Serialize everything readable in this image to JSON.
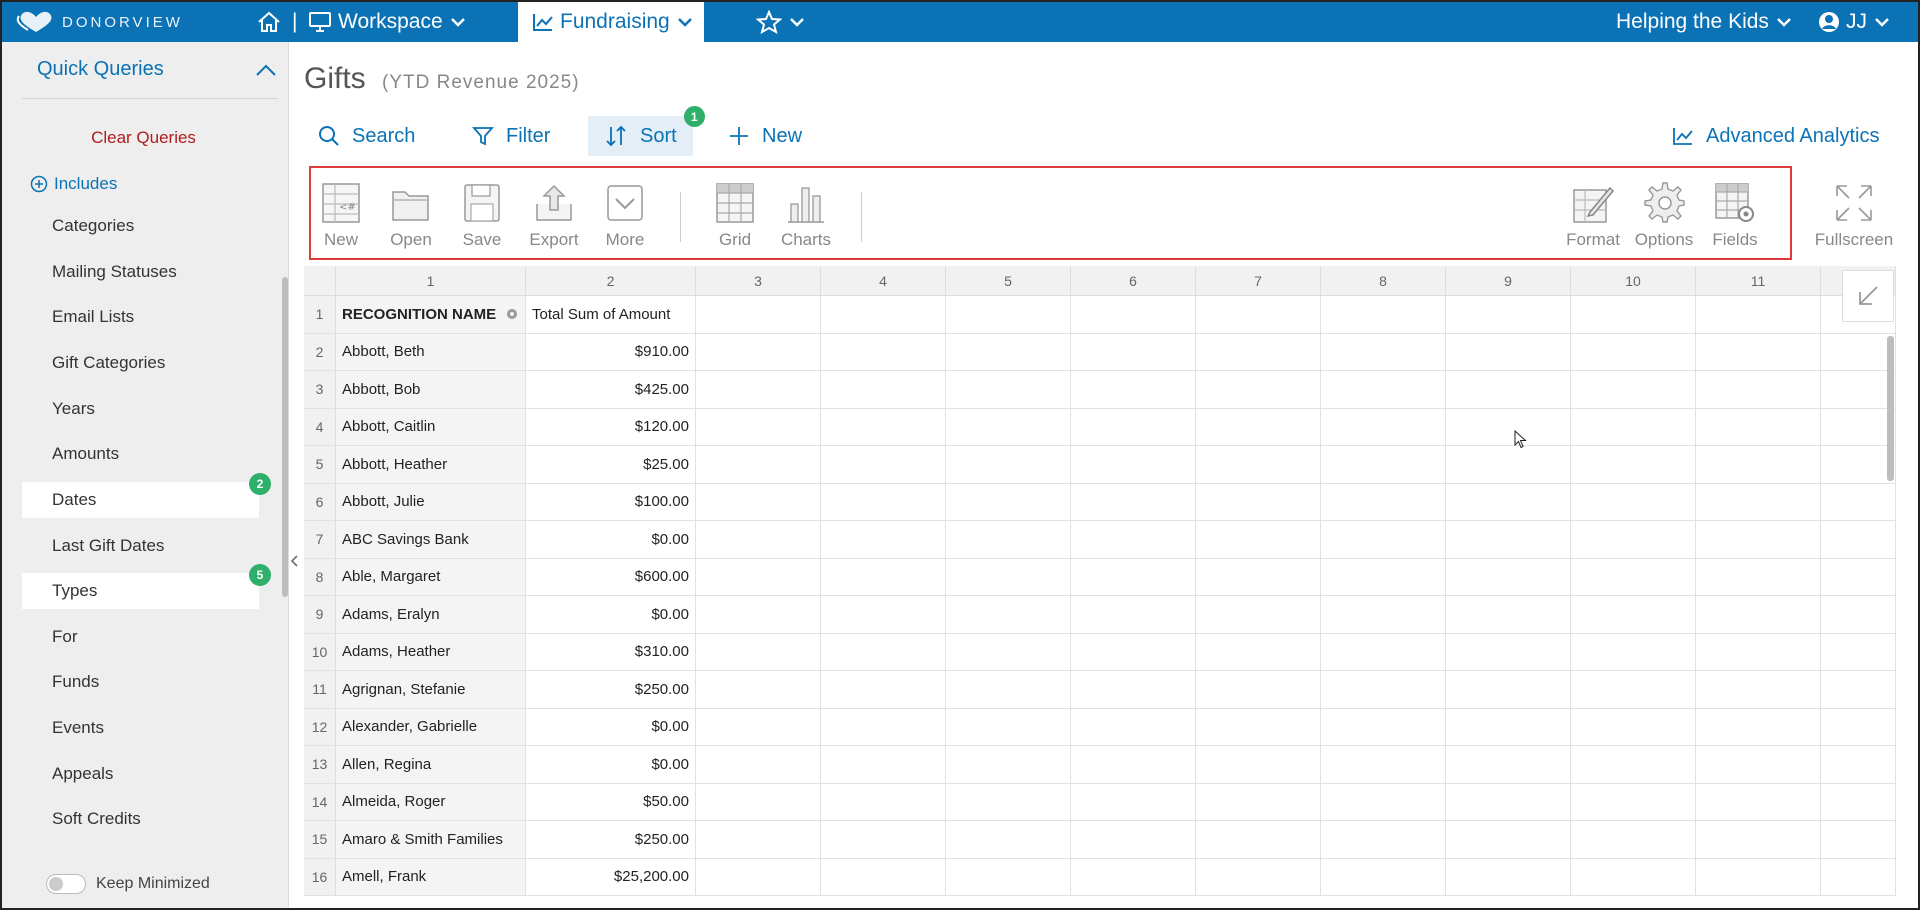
{
  "nav": {
    "logo_text": "DONORVIEW",
    "workspace_label": "Workspace",
    "fundraising_label": "Fundraising",
    "org_label": "Helping the Kids",
    "user_label": "JJ",
    "brand_color": "#0b72b5"
  },
  "sidebar": {
    "title": "Quick Queries",
    "clear_label": "Clear Queries",
    "includes_label": "Includes",
    "items": [
      {
        "label": "Categories"
      },
      {
        "label": "Mailing Statuses"
      },
      {
        "label": "Email Lists"
      },
      {
        "label": "Gift Categories"
      },
      {
        "label": "Years"
      },
      {
        "label": "Amounts"
      },
      {
        "label": "Dates",
        "badge": "2"
      },
      {
        "label": "Last Gift Dates"
      },
      {
        "label": "Types",
        "badge": "5"
      },
      {
        "label": "For"
      },
      {
        "label": "Funds"
      },
      {
        "label": "Events"
      },
      {
        "label": "Appeals"
      },
      {
        "label": "Soft Credits"
      }
    ],
    "keep_minimized_label": "Keep Minimized"
  },
  "page": {
    "title": "Gifts",
    "subtitle": "(YTD Revenue 2025)"
  },
  "actions": {
    "search": "Search",
    "filter": "Filter",
    "sort": "Sort",
    "sort_badge": "1",
    "new": "New",
    "analytics": "Advanced Analytics"
  },
  "toolbar": {
    "new": "New",
    "open": "Open",
    "save": "Save",
    "export": "Export",
    "more": "More",
    "grid": "Grid",
    "charts": "Charts",
    "format": "Format",
    "options": "Options",
    "fields": "Fields",
    "fullscreen": "Fullscreen"
  },
  "grid": {
    "columns": [
      "1",
      "2",
      "3",
      "4",
      "5",
      "6",
      "7",
      "8",
      "9",
      "10",
      "11"
    ],
    "header_name": "RECOGNITION NAME",
    "header_amount": "Total Sum of Amount",
    "rows": [
      {
        "n": "2",
        "name": "Abbott, Beth",
        "amount": "$910.00"
      },
      {
        "n": "3",
        "name": "Abbott, Bob",
        "amount": "$425.00"
      },
      {
        "n": "4",
        "name": "Abbott, Caitlin",
        "amount": "$120.00"
      },
      {
        "n": "5",
        "name": "Abbott, Heather",
        "amount": "$25.00"
      },
      {
        "n": "6",
        "name": "Abbott, Julie",
        "amount": "$100.00"
      },
      {
        "n": "7",
        "name": "ABC Savings Bank",
        "amount": "$0.00"
      },
      {
        "n": "8",
        "name": "Able, Margaret",
        "amount": "$600.00"
      },
      {
        "n": "9",
        "name": "Adams, Eralyn",
        "amount": "$0.00"
      },
      {
        "n": "10",
        "name": "Adams, Heather",
        "amount": "$310.00"
      },
      {
        "n": "11",
        "name": "Agrignan, Stefanie",
        "amount": "$250.00"
      },
      {
        "n": "12",
        "name": "Alexander, Gabrielle",
        "amount": "$0.00"
      },
      {
        "n": "13",
        "name": "Allen, Regina",
        "amount": "$0.00"
      },
      {
        "n": "14",
        "name": "Almeida, Roger",
        "amount": "$50.00"
      },
      {
        "n": "15",
        "name": "Amaro & Smith Families",
        "amount": "$250.00"
      },
      {
        "n": "16",
        "name": "Amell, Frank",
        "amount": "$25,200.00"
      }
    ]
  }
}
